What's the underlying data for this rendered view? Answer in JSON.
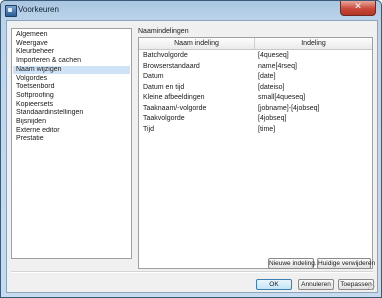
{
  "window": {
    "title": "Voorkeuren",
    "close_glyph": "✕"
  },
  "sidebar": {
    "items": [
      {
        "label": "Algemeen"
      },
      {
        "label": "Weergave"
      },
      {
        "label": "Kleurbeheer"
      },
      {
        "label": "Importeren & cachen"
      },
      {
        "label": "Naam wijzigen",
        "selected": true
      },
      {
        "label": "Volgordes"
      },
      {
        "label": "Toetsenbord"
      },
      {
        "label": "Softproofing"
      },
      {
        "label": "Kopieersets"
      },
      {
        "label": "Standaardinstellingen"
      },
      {
        "label": "Bijsnijden"
      },
      {
        "label": "Externe editor"
      },
      {
        "label": "Prestatie"
      }
    ]
  },
  "main": {
    "section_title": "Naamindelingen",
    "table": {
      "columns": [
        "Naam indeling",
        "Indeling"
      ],
      "rows": [
        [
          "Batchvolgorde",
          "[4queseq]"
        ],
        [
          "Browserstandaard",
          "name[4rseq]"
        ],
        [
          "Datum",
          "[date]"
        ],
        [
          "Datum en tijd",
          "[dateiso]"
        ],
        [
          "Kleine afbeeldingen",
          "small[4queseq]"
        ],
        [
          "Taaknaam/-volgorde",
          "[jobname]-[4jobseq]"
        ],
        [
          "Taakvolgorde",
          "[4jobseq]"
        ],
        [
          "Tijd",
          "[time]"
        ]
      ]
    },
    "buttons": {
      "new_format": "Nieuwe indeling...",
      "delete_current": "Huidige verwijderen"
    }
  },
  "footer": {
    "ok": "OK",
    "cancel": "Annuleren",
    "apply": "Toepassen"
  }
}
